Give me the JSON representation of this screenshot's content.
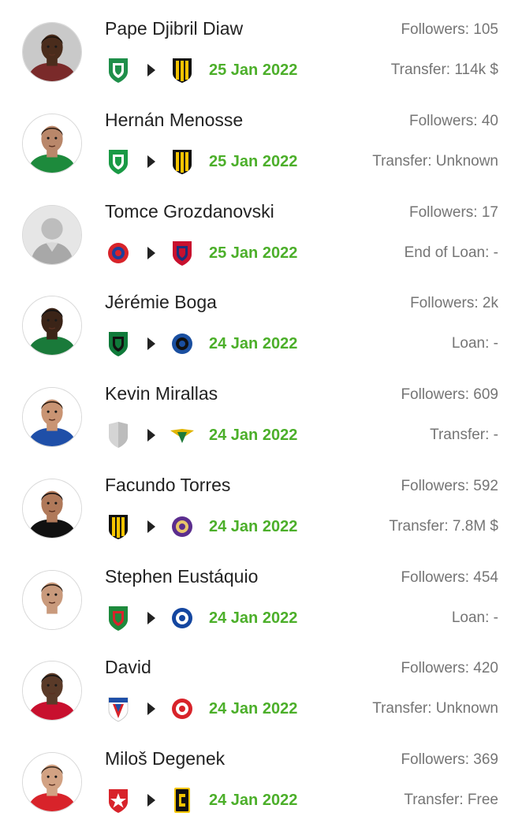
{
  "transfers": [
    {
      "player": "Pape Djibril Diaw",
      "followers": "Followers: 105",
      "date": "25 Jan 2022",
      "transfer": "Transfer: 114k $",
      "avatar": {
        "skin": "#4a2c1c",
        "shirt": "#7a2a2a",
        "bg": "#c9c9c9",
        "hair": "#1a120c"
      },
      "from_club": {
        "icon": "green-club-crest-icon",
        "color1": "#1f8f4a",
        "color2": "#ffffff"
      },
      "to_club": {
        "icon": "yellow-black-stripes-crest-icon",
        "color1": "#f3c200",
        "color2": "#111111"
      }
    },
    {
      "player": "Hernán Menosse",
      "followers": "Followers: 40",
      "date": "25 Jan 2022",
      "transfer": "Transfer: Unknown",
      "avatar": {
        "skin": "#b9876a",
        "shirt": "#1d8a3c",
        "bg": "#ffffff",
        "hair": "#2b1b12"
      },
      "from_club": {
        "icon": "green-white-cali-crest-icon",
        "color1": "#1a9a45",
        "color2": "#ffffff"
      },
      "to_club": {
        "icon": "penarol-crest-icon",
        "color1": "#f5c400",
        "color2": "#111111"
      }
    },
    {
      "player": "Tomce Grozdanovski",
      "followers": "Followers: 17",
      "date": "25 Jan 2022",
      "transfer": "End of Loan: -",
      "avatar": {
        "skin": "#bdbdbd",
        "shirt": "#a8a8a8",
        "bg": "#e6e6e6",
        "hair": "#bdbdbd"
      },
      "from_club": {
        "icon": "red-blue-round-crest-icon",
        "color1": "#d8232a",
        "color2": "#1e3f9a"
      },
      "to_club": {
        "icon": "red-blue-shield-crest-icon",
        "color1": "#c8102e",
        "color2": "#1c2f7a"
      }
    },
    {
      "player": "Jérémie Boga",
      "followers": "Followers: 2k",
      "date": "24 Jan 2022",
      "transfer": "Loan: -",
      "avatar": {
        "skin": "#3b2417",
        "shirt": "#1a7a3a",
        "bg": "#ffffff",
        "hair": "#111111"
      },
      "from_club": {
        "icon": "sassuolo-crest-icon",
        "color1": "#0f7a3a",
        "color2": "#111111"
      },
      "to_club": {
        "icon": "atalanta-crest-icon",
        "color1": "#1a4fa0",
        "color2": "#111111"
      }
    },
    {
      "player": "Kevin Mirallas",
      "followers": "Followers: 609",
      "date": "24 Jan 2022",
      "transfer": "Transfer: -",
      "avatar": {
        "skin": "#c99473",
        "shirt": "#1f4fa8",
        "bg": "#ffffff",
        "hair": "#2a1a10"
      },
      "from_club": {
        "icon": "blank-shield-icon",
        "color1": "#d4d4d4",
        "color2": "#bcbcbc"
      },
      "to_club": {
        "icon": "moreirense-crest-icon",
        "color1": "#1e7a3a",
        "color2": "#e0b400"
      }
    },
    {
      "player": "Facundo Torres",
      "followers": "Followers: 592",
      "date": "24 Jan 2022",
      "transfer": "Transfer: 7.8M $",
      "avatar": {
        "skin": "#b0795a",
        "shirt": "#111111",
        "bg": "#ffffff",
        "hair": "#151010"
      },
      "from_club": {
        "icon": "penarol-crest-icon",
        "color1": "#f5c400",
        "color2": "#111111"
      },
      "to_club": {
        "icon": "orlando-city-crest-icon",
        "color1": "#5b2d8e",
        "color2": "#e8c56a"
      }
    },
    {
      "player": "Stephen Eustáquio",
      "followers": "Followers: 454",
      "date": "24 Jan 2022",
      "transfer": "Loan: -",
      "avatar": {
        "skin": "#c99a7c",
        "shirt": "#ffffff",
        "bg": "#ffffff",
        "hair": "#2b1d14"
      },
      "from_club": {
        "icon": "pacos-ferreira-crest-icon",
        "color1": "#1d8a3c",
        "color2": "#d8232a"
      },
      "to_club": {
        "icon": "fc-porto-crest-icon",
        "color1": "#1446a0",
        "color2": "#ffffff"
      }
    },
    {
      "player": "David",
      "followers": "Followers: 420",
      "date": "24 Jan 2022",
      "transfer": "Transfer: Unknown",
      "avatar": {
        "skin": "#5a3a28",
        "shirt": "#c8102e",
        "bg": "#ffffff",
        "hair": "#111111"
      },
      "from_club": {
        "icon": "fortaleza-crest-icon",
        "color1": "#1e4fa8",
        "color2": "#d8232a"
      },
      "to_club": {
        "icon": "internacional-crest-icon",
        "color1": "#d8232a",
        "color2": "#ffffff"
      }
    },
    {
      "player": "Miloš Degenek",
      "followers": "Followers: 369",
      "date": "24 Jan 2022",
      "transfer": "Transfer: Free",
      "avatar": {
        "skin": "#d2a283",
        "shirt": "#d8232a",
        "bg": "#ffffff",
        "hair": "#3a2a1e"
      },
      "from_club": {
        "icon": "red-star-crest-icon",
        "color1": "#d8232a",
        "color2": "#ffffff"
      },
      "to_club": {
        "icon": "columbus-crew-crest-icon",
        "color1": "#111111",
        "color2": "#f5c400"
      }
    }
  ]
}
